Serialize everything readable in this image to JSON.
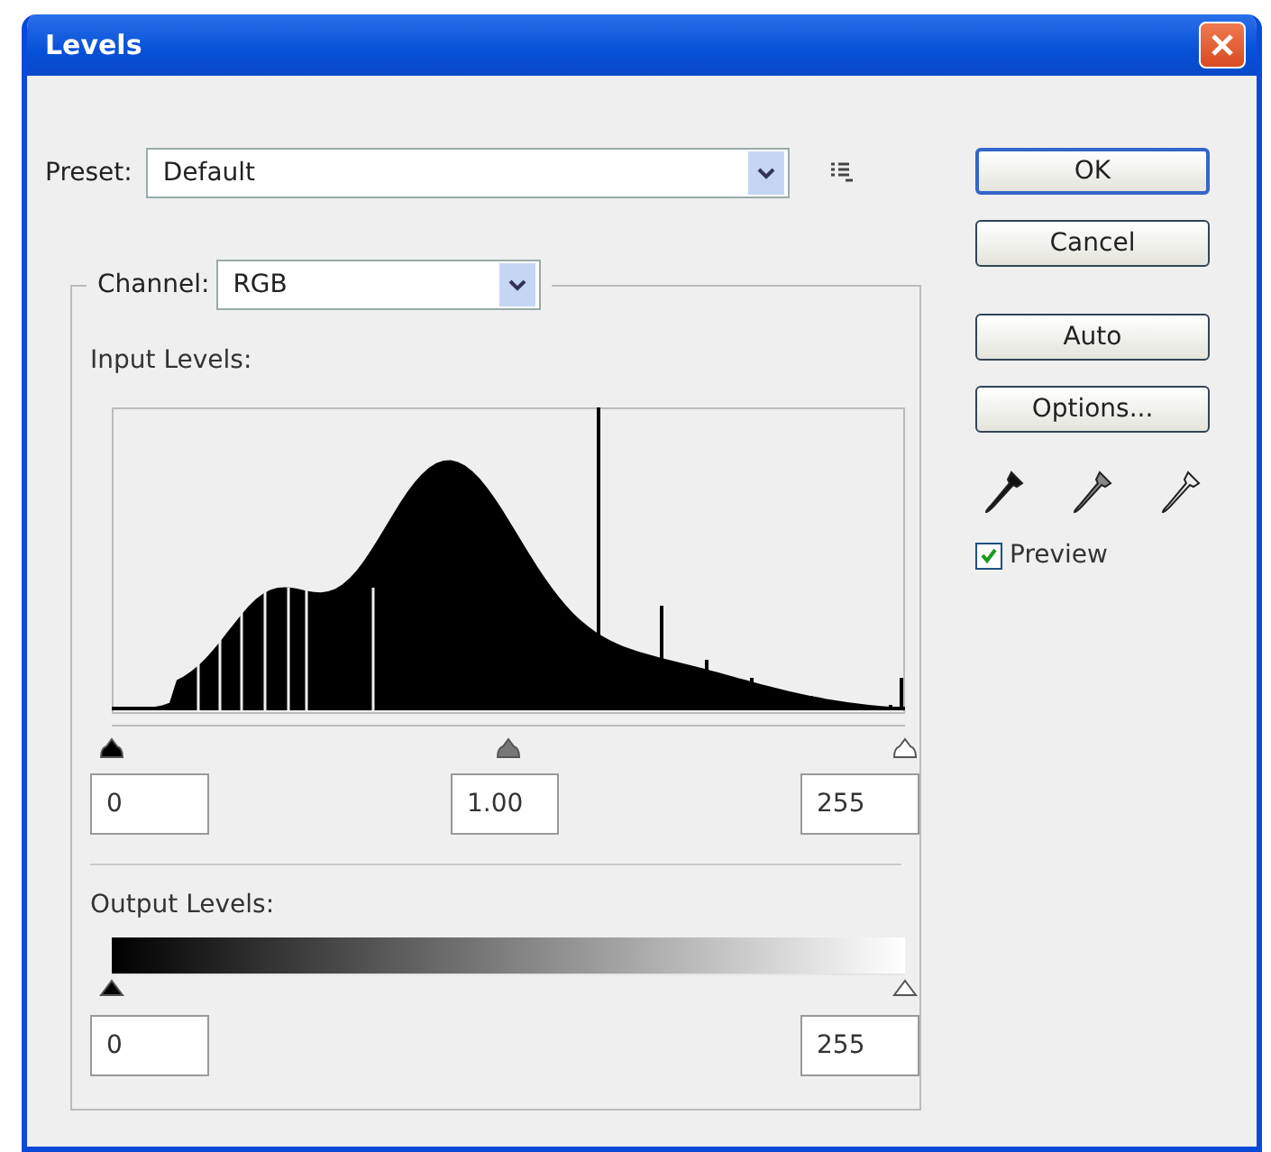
{
  "window": {
    "title": "Levels"
  },
  "preset": {
    "label": "Preset:",
    "value": "Default"
  },
  "channel": {
    "label": "Channel:",
    "value": "RGB"
  },
  "input_levels": {
    "label": "Input Levels:",
    "handles": [
      {
        "kind": "black",
        "level": 0
      },
      {
        "kind": "gray",
        "level": 0.5
      },
      {
        "kind": "white",
        "level": 1
      }
    ],
    "fields": [
      "0",
      "1.00",
      "255"
    ]
  },
  "output_levels": {
    "label": "Output Levels:",
    "handles": [
      {
        "kind": "black",
        "level": 0
      },
      {
        "kind": "white",
        "level": 1
      }
    ],
    "fields": [
      "0",
      "255"
    ]
  },
  "buttons": [
    {
      "label": "OK",
      "default": true
    },
    {
      "label": "Cancel",
      "default": false
    },
    {
      "label": "Auto",
      "default": false
    },
    {
      "label": "Options...",
      "default": false
    }
  ],
  "eyedroppers": [
    {
      "kind": "black"
    },
    {
      "kind": "gray"
    },
    {
      "kind": "white"
    }
  ],
  "preview": {
    "label": "Preview",
    "checked": true
  }
}
